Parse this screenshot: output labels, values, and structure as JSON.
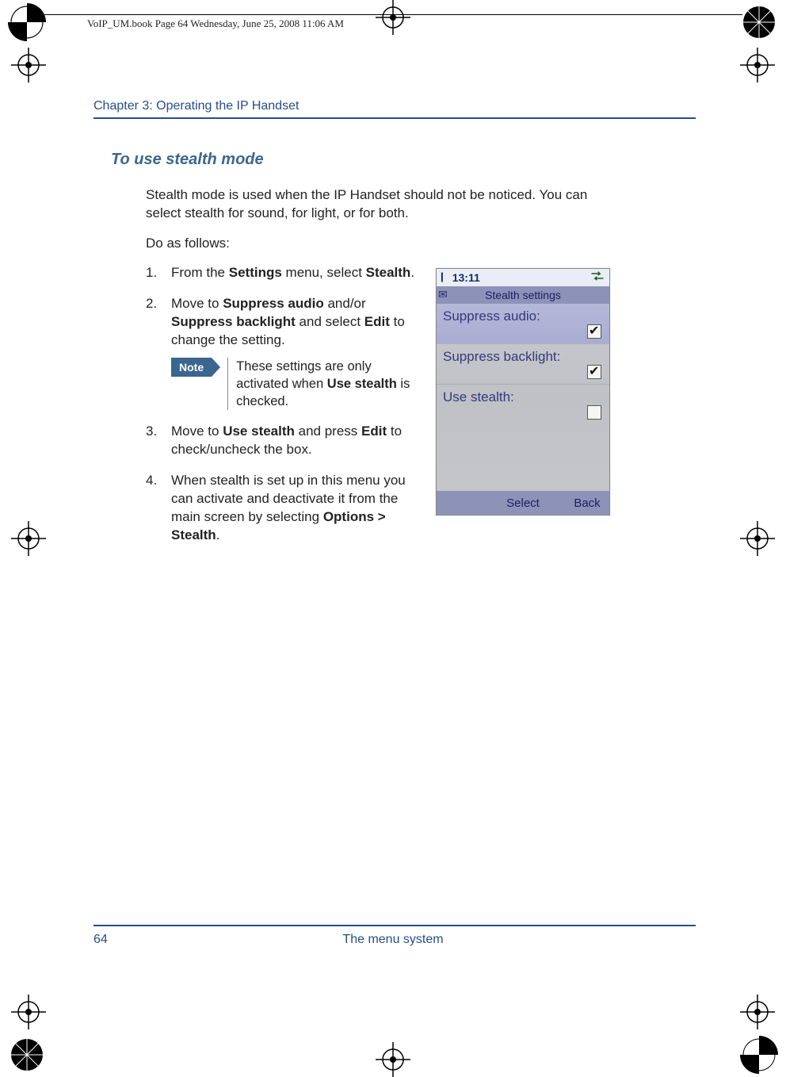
{
  "print_header": "VoIP_UM.book  Page 64  Wednesday, June 25, 2008  11:06 AM",
  "chapter_header": "Chapter 3:  Operating the IP Handset",
  "section_title": "To use stealth mode",
  "intro": "Stealth mode is used when the IP Handset should not be noticed. You can select stealth for sound, for light, or for both.",
  "do_as": "Do as follows:",
  "steps": {
    "s1": {
      "num": "1.",
      "pre": "From the ",
      "b1": "Settings",
      "mid": " menu, select ",
      "b2": "Stealth",
      "post": "."
    },
    "s2": {
      "num": "2.",
      "pre": "Move to ",
      "b1": "Suppress audio",
      "mid1": " and/or ",
      "b2": "Suppress backlight",
      "mid2": " and select ",
      "b3": "Edit",
      "post": " to change the setting."
    },
    "note": {
      "label": "Note",
      "pre": "These settings are only activated when ",
      "b1": "Use stealth",
      "post": " is checked."
    },
    "s3": {
      "num": "3.",
      "pre": "Move to ",
      "b1": "Use stealth",
      "mid": " and press ",
      "b2": "Edit",
      "post": " to check/uncheck the box."
    },
    "s4": {
      "num": "4.",
      "pre": "When stealth is set up in this menu you can activate and deactivate it from the main screen by selecting ",
      "b1": "Options > Stealth",
      "post": "."
    }
  },
  "phone": {
    "time": "13:11",
    "title": "Stealth settings",
    "row1": "Suppress audio:",
    "row2": "Suppress backlight:",
    "row3": "Use stealth:",
    "row1_checked": true,
    "row2_checked": true,
    "row3_checked": false,
    "sk_center": "Select",
    "sk_right": "Back"
  },
  "footer": {
    "page": "64",
    "center": "The menu system"
  }
}
